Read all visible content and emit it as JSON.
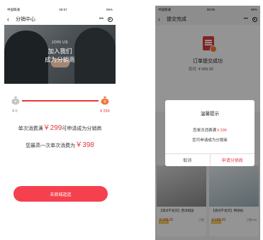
{
  "left": {
    "status": {
      "carrier": "中国联通",
      "time": "08:57",
      "battery": "96%"
    },
    "nav": {
      "back": "‹",
      "title": "分销中心",
      "more": "•••"
    },
    "banner": {
      "en": "JOIN US",
      "line1": "加入我们",
      "line2": "成为分销商"
    },
    "progress": {
      "start": "￥0",
      "end": "￥299",
      "fraction": 1.0
    },
    "info": {
      "line1_pre": "单次消费满",
      "line1_price": "￥299",
      "line1_post": "可申请成为分销商",
      "line2_pre": "您最高一次单次消费为",
      "line2_price": "￥398"
    },
    "cta": "去商城逛逛"
  },
  "right": {
    "status": {
      "carrier": "中国联通",
      "time": "08:59",
      "battery": "96%"
    },
    "nav": {
      "back": "‹",
      "title": "提交完成",
      "more": "•••"
    },
    "order": {
      "title": "订单提交成功",
      "amount": "实付 ￥499.00"
    },
    "goods": [
      {
        "name": "【测试不发货】西洋棋国",
        "tag": "会员价",
        "price": "￥199.00",
        "sold": "已售"
      },
      {
        "name": "【测试不发货】网球拍",
        "tag": "会员价",
        "price": "￥199.00",
        "sold": "已售298"
      }
    ],
    "dialog": {
      "title": "温馨提示",
      "line1_pre": "您单次消费满",
      "line1_price": "￥299",
      "line2": "您可申请成为分销商",
      "cancel": "取消",
      "confirm": "申请分销商"
    }
  },
  "colors": {
    "accent": "#e4393c",
    "cta": "#f5414f"
  }
}
